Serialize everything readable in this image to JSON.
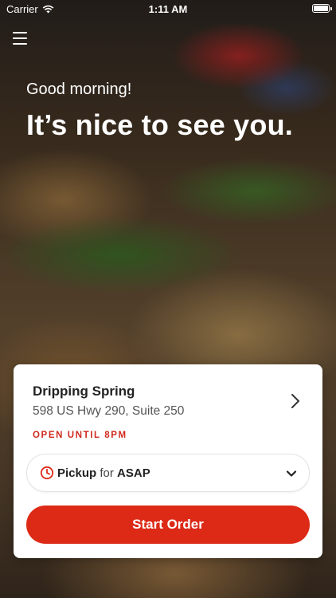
{
  "status_bar": {
    "carrier": "Carrier",
    "time": "1:11 AM",
    "wifi_icon": "wifi-icon",
    "battery_icon": "battery-icon"
  },
  "header": {
    "menu_icon": "hamburger-menu-icon",
    "greeting": "Good morning!",
    "headline": "It’s nice to see you."
  },
  "store": {
    "name": "Dripping Spring",
    "address": "598 US Hwy 290, Suite 250",
    "hours_status": "OPEN UNTIL 8PM",
    "chevron_icon": "chevron-right-icon"
  },
  "order_mode": {
    "clock_icon": "clock-icon",
    "mode": "Pickup",
    "connector": "for",
    "time": "ASAP",
    "dropdown_icon": "chevron-down-icon"
  },
  "cta": {
    "label": "Start Order"
  },
  "colors": {
    "accent": "#dc2a17",
    "status_red": "#cf2a1f",
    "card_bg": "#ffffff"
  }
}
